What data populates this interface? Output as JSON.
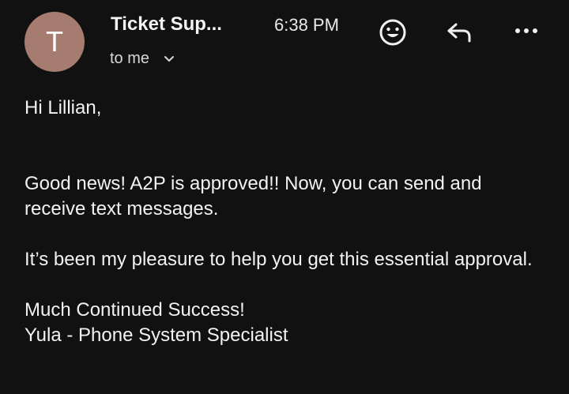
{
  "header": {
    "avatar_letter": "T",
    "sender_name": "Ticket Sup...",
    "time": "6:38 PM",
    "recipient": "to me",
    "icons": {
      "emoji": "smiley-face-icon",
      "reply": "reply-arrow-icon",
      "more": "more-options-icon",
      "chevron": "chevron-down-icon"
    }
  },
  "message": {
    "greeting": "Hi Lillian,",
    "paragraph1": "Good news! A2P is approved!! Now, you can send and receive text messages.",
    "paragraph2": "It’s been my pleasure to help you get this essential approval.",
    "closing": "Much Continued Success!",
    "signature": "Yula - Phone System Specialist"
  },
  "colors": {
    "background": "#111112",
    "avatar": "#a67b70",
    "text": "#f2f2f2"
  }
}
